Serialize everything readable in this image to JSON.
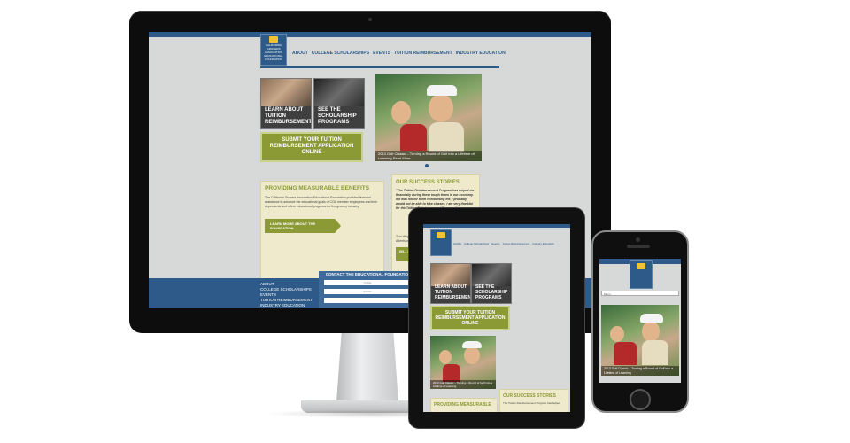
{
  "desktop": {
    "nav": [
      "ABOUT",
      "COLLEGE SCHOLARSHIPS",
      "EVENTS",
      "TUITION REIMBURSEMENT",
      "INDUSTRY EDUCATION"
    ],
    "logo_text": "CALIFORNIA GROCERS ASSOCIATION EDUCATIONAL FOUNDATION",
    "promo_left": "LEARN ABOUT TUITION REIMBURSEMENT",
    "promo_right": "SEE THE SCHOLARSHIP PROGRAMS",
    "cta": "SUBMIT YOUR TUITION REIMBURSEMENT APPLICATION ONLINE",
    "slide_caption": "2013 Golf Classic – Turning a Round of Golf into a Lifetime of Learning",
    "slide_caption_link": "Read More",
    "benefits_title": "PROVIDING MEASURABLE BENEFITS",
    "benefits_text": "The California Grocers Association Educational Foundation provides financial assistance to advance the educational goals of CGA member employees and their dependents and offers educational programs for the grocery industry.",
    "benefits_button": "LEARN MORE ABOUT THE FOUNDATION",
    "stories_title": "OUR SUCCESS STORIES",
    "stories_quote": "\"The Tuition Reimbursement Program has helped me financially during these tough times in our economy. If it was not for them reimbursing me, I probably would not be able to take classes. I am very thankful for the Tuition Reimbursement Program.\"",
    "stories_name": "Tom Wright",
    "stories_company": "Albertsons",
    "stories_button": "WI... DO...",
    "contact_title": "CONTACT THE EDUCATIONAL FOUNDATION",
    "contact_fields": [
      "NAME",
      "EMAIL",
      ""
    ],
    "footer_links": [
      "ABOUT",
      "COLLEGE SCHOLARSHIPS",
      "EVENTS",
      "TUITION REIMBURSEMENT",
      "INDUSTRY EDUCATION"
    ]
  },
  "tablet": {
    "nav": [
      "HOME",
      "College Scholarships",
      "Events",
      "Tuition Reimbursement",
      "Industry Education"
    ],
    "promo_left": "LEARN ABOUT TUITION REIMBURSEMENT",
    "promo_right": "SEE THE SCHOLARSHIP PROGRAMS",
    "cta": "SUBMIT YOUR TUITION REIMBURSEMENT APPLICATION ONLINE",
    "slide_caption": "2013 Golf Classic – Turning a Round of Golf into a Lifetime of Learning",
    "stories_title": "OUR SUCCESS STORIES",
    "stories_text": "The Tuition Reimbursement Program has helped",
    "benefits_title": "PROVIDING MEASURABLE"
  },
  "phone": {
    "menu_label": "Menu",
    "slide_caption": "2013 Golf Classic – Turning a Round of Golf into a Lifetime of Learning"
  },
  "colors": {
    "brand_blue": "#2d5a88",
    "olive": "#8c9a36",
    "panel": "#eeeacb"
  }
}
